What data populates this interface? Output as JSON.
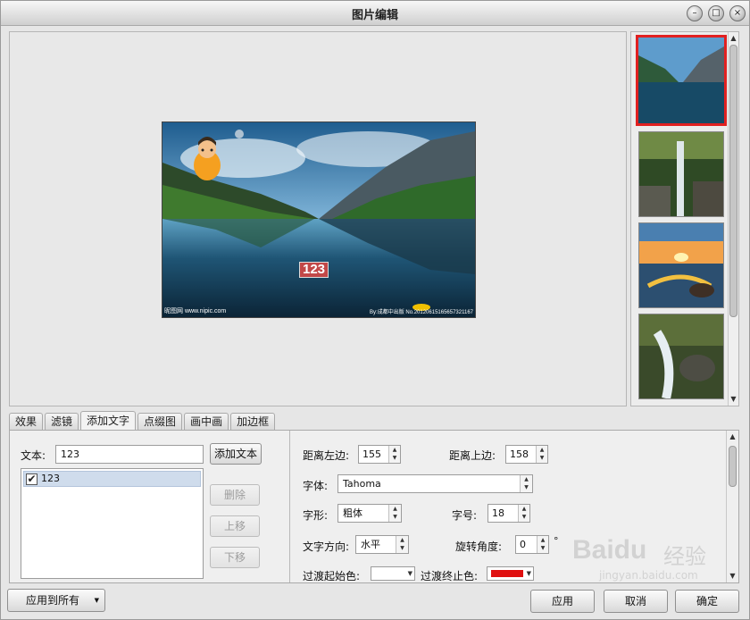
{
  "window": {
    "title": "图片编辑"
  },
  "title_buttons": {
    "minimize": "–",
    "maximize": "□",
    "close": "×"
  },
  "preview": {
    "overlay_text": "123",
    "watermark_left": "昵图网 www.nipic.com",
    "watermark_right": "By:成都中出版 No.20120615165657321167"
  },
  "thumbnails": [
    {
      "name": "lake-mountains",
      "selected": true
    },
    {
      "name": "waterfall-forest",
      "selected": false
    },
    {
      "name": "sunset-beach",
      "selected": false
    },
    {
      "name": "stream-rocks",
      "selected": false
    }
  ],
  "tabs": [
    "效果",
    "滤镜",
    "添加文字",
    "点缀图",
    "画中画",
    "加边框"
  ],
  "active_tab": "添加文字",
  "text_panel": {
    "text_label": "文本:",
    "text_value": "123",
    "add_button": "添加文本",
    "list_items": [
      {
        "label": "123",
        "checked": true
      }
    ],
    "delete_button": "删除",
    "move_up_button": "上移",
    "move_down_button": "下移"
  },
  "props": {
    "left_label": "距离左边:",
    "left_value": "155",
    "top_label": "距离上边:",
    "top_value": "158",
    "font_label": "字体:",
    "font_value": "Tahoma",
    "style_label": "字形:",
    "style_value": "粗体",
    "size_label": "字号:",
    "size_value": "18",
    "direction_label": "文字方向:",
    "direction_value": "水平",
    "rotation_label": "旋转角度:",
    "rotation_value": "0",
    "rotation_unit": "°",
    "grad_start_label": "过渡起始色:",
    "grad_start_color": "#ffffff",
    "grad_end_label": "过渡终止色:",
    "grad_end_color": "#e01010"
  },
  "bottom": {
    "apply_all": "应用到所有",
    "apply": "应用",
    "cancel": "取消",
    "ok": "确定"
  },
  "watermark": {
    "brand": "Baidu",
    "tail": "经验",
    "url": "jingyan.baidu.com"
  }
}
